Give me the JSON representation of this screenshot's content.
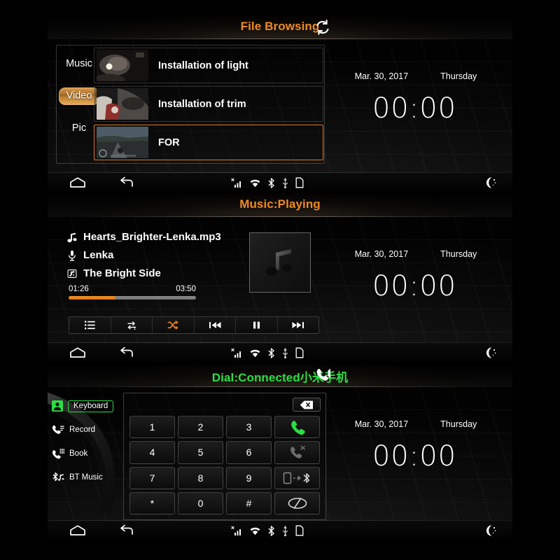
{
  "datetime": {
    "date": "Mar. 30,  2017",
    "weekday": "Thursday",
    "time": "00:00"
  },
  "panels": {
    "files": {
      "title": "File Browsing",
      "title_icon": "refresh-icon",
      "tabs": [
        {
          "label": "Music",
          "active": false
        },
        {
          "label": "Video",
          "active": true
        },
        {
          "label": "Pic",
          "active": false
        }
      ],
      "rows": [
        {
          "label": "Installation of light",
          "selected": false,
          "thumb": "dark-engine-bay-photo"
        },
        {
          "label": "Installation of trim",
          "selected": false,
          "thumb": "car-door-panel-photo"
        },
        {
          "label": "FOR",
          "selected": true,
          "thumb": "highway-driving-photo"
        }
      ]
    },
    "music": {
      "title": "Music:Playing",
      "track": "Hearts_Brighter-Lenka.mp3",
      "artist": "Lenka",
      "album": "The Bright Side",
      "elapsed": "01:26",
      "duration": "03:50",
      "progress_percent": 37,
      "album_art_icon": "music-note-icon",
      "controls": [
        {
          "name": "playlist-button",
          "icon": "list-icon",
          "active": false
        },
        {
          "name": "repeat-button",
          "icon": "repeat-one-icon",
          "active": false
        },
        {
          "name": "shuffle-button",
          "icon": "shuffle-icon",
          "active": true
        },
        {
          "name": "previous-button",
          "icon": "prev-icon",
          "active": false
        },
        {
          "name": "pause-button",
          "icon": "pause-icon",
          "active": false
        },
        {
          "name": "next-button",
          "icon": "next-icon",
          "active": false
        }
      ]
    },
    "dial": {
      "title": "Dial:Connected小米手机",
      "title_icon": "phone-speaker-icon",
      "sidebar": [
        {
          "label": "Keyboard",
          "icon": "keyboard-contact-icon",
          "active": true
        },
        {
          "label": "Record",
          "icon": "call-log-icon",
          "active": false
        },
        {
          "label": "Book",
          "icon": "phonebook-icon",
          "active": false
        },
        {
          "label": "BT Music",
          "icon": "bt-music-icon",
          "active": false
        }
      ],
      "delete_icon": "backspace-icon",
      "keys": [
        {
          "label": "1",
          "icon": null
        },
        {
          "label": "2",
          "icon": null
        },
        {
          "label": "3",
          "icon": null
        },
        {
          "label": "",
          "icon": "call-icon"
        },
        {
          "label": "4",
          "icon": null
        },
        {
          "label": "5",
          "icon": null
        },
        {
          "label": "6",
          "icon": null
        },
        {
          "label": "",
          "icon": "end-call-icon"
        },
        {
          "label": "7",
          "icon": null
        },
        {
          "label": "8",
          "icon": null
        },
        {
          "label": "9",
          "icon": null
        },
        {
          "label": "",
          "icon": "transfer-bt-icon"
        },
        {
          "label": "*",
          "icon": null
        },
        {
          "label": "0",
          "icon": null
        },
        {
          "label": "#",
          "icon": null
        },
        {
          "label": "",
          "icon": "hide-pad-icon"
        }
      ]
    }
  },
  "statusbar": {
    "home": "home-icon",
    "back": "back-icon",
    "tray": [
      "signal-no-service-icon",
      "wifi-icon",
      "bluetooth-icon",
      "usb-icon",
      "sim-card-icon"
    ],
    "night": "moon-icon"
  },
  "colors": {
    "accent_orange": "#f08a20",
    "accent_green": "#2bdd44",
    "progress_fill": "#ef8a1e",
    "panel_bg": "#060606"
  }
}
